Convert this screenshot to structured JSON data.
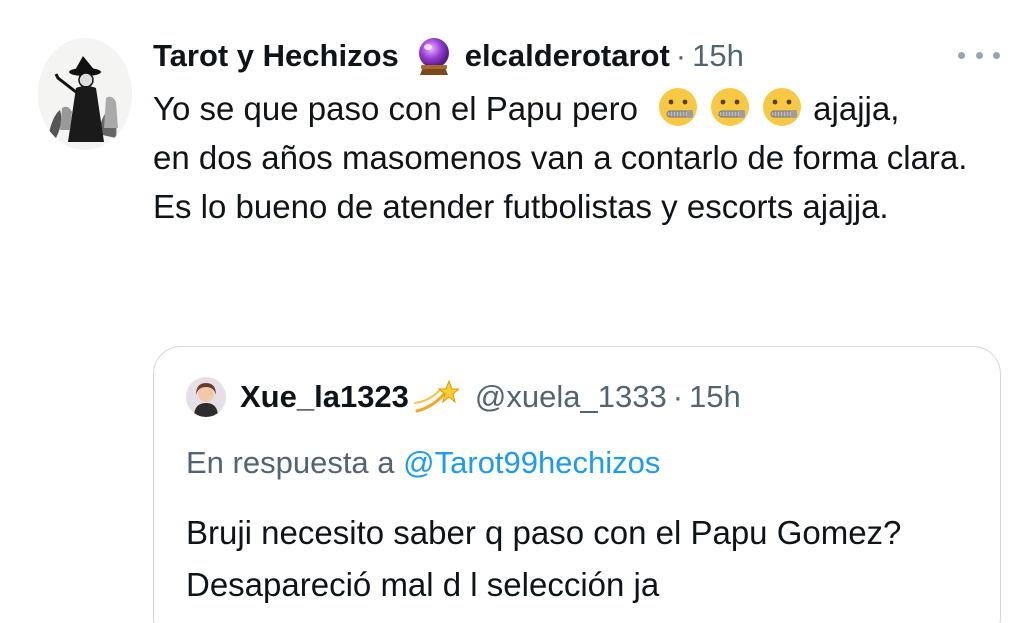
{
  "tweet": {
    "avatar_icon": "witch-illustration-avatar",
    "display_name": "Tarot y Hechizos",
    "badge_icon": "crystal-ball-icon",
    "handle": "elcalderotarot",
    "separator": "·",
    "time": "15h",
    "more_icon": "more-options-icon",
    "body": {
      "line1_text": "Yo se que paso con el Papu pero",
      "emoji": "zipper-mouth-face-icon",
      "emoji_count": 3,
      "line1_after": "ajajja,",
      "line2": "en dos años masomenos van a contarlo de forma clara.",
      "line3": "Es lo bueno de atender futbolistas y escorts ajajja."
    }
  },
  "quote": {
    "avatar_icon": "user-avatar-icon",
    "display_name": "Xue_la1323",
    "name_icon": "shooting-star-icon",
    "handle": "@xuela_1333",
    "separator": "·",
    "time": "15h",
    "reply_prefix": "En respuesta a",
    "reply_mention": "@Tarot99hechizos",
    "text": "Bruji necesito saber q paso con el Papu Gomez? Desapareció mal d l selección ja"
  },
  "colors": {
    "text_primary": "#0f1419",
    "text_secondary": "#536471",
    "link": "#1d9bf0",
    "border": "#cfd9de"
  }
}
